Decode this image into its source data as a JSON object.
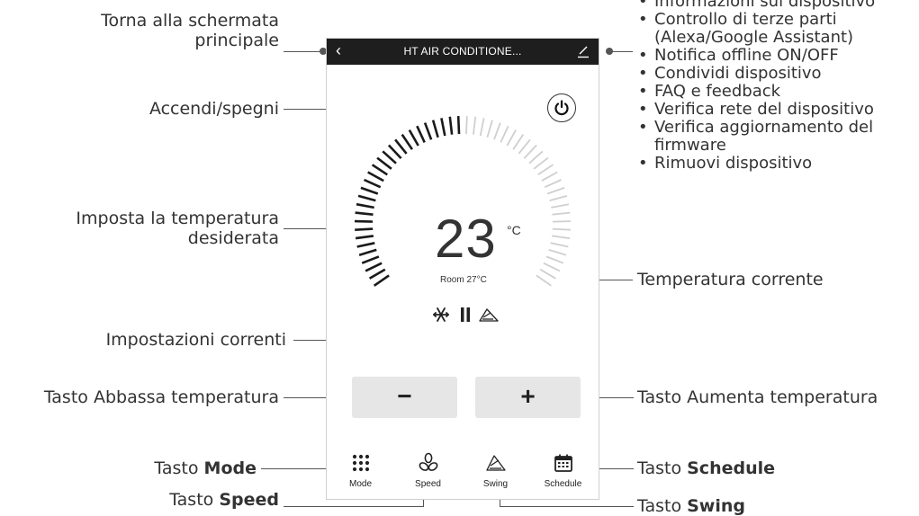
{
  "phone": {
    "title": "HT AIR CONDITIONE...",
    "back_icon": "chevron-left-icon",
    "edit_icon": "pencil-icon",
    "set_temperature": "23",
    "unit": "°C",
    "room_temperature": "Room 27°C",
    "decrease_label": "−",
    "increase_label": "+",
    "bottom_nav": [
      {
        "label": "Mode",
        "icon": "grid-dots-icon"
      },
      {
        "label": "Speed",
        "icon": "fan-icon"
      },
      {
        "label": "Swing",
        "icon": "swing-icon"
      },
      {
        "label": "Schedule",
        "icon": "calendar-icon"
      }
    ]
  },
  "callouts": {
    "home": "Torna alla schermata\nprincipale",
    "home_line1": "Torna alla schermata",
    "home_line2": "principale",
    "power": "Accendi/spegni",
    "set_temp_line1": "Imposta la temperatura",
    "set_temp_line2": "desiderata",
    "current_settings": "Impostazioni correnti",
    "decrease": "Tasto Abbassa temperatura",
    "mode_prefix": "Tasto ",
    "mode_bold": "Mode",
    "speed_prefix": "Tasto ",
    "speed_bold": "Speed",
    "current_temp": "Temperatura corrente",
    "increase": "Tasto Aumenta temperatura",
    "schedule_prefix": "Tasto ",
    "schedule_bold": "Schedule",
    "swing_prefix": "Tasto ",
    "swing_bold": "Swing"
  },
  "settings_menu": [
    "Informazioni sul dispositivo",
    "Controllo di terze parti",
    "(Alexa/Google Assistant)",
    "Notifica offline ON/OFF",
    "Condividi dispositivo",
    "FAQ e feedback",
    "Verifica rete del dispositivo",
    "Verifica aggiornamento del",
    "firmware",
    "Rimuovi dispositivo"
  ],
  "dial": {
    "min": 16,
    "max": 30,
    "value": 23,
    "ticks": 56
  }
}
